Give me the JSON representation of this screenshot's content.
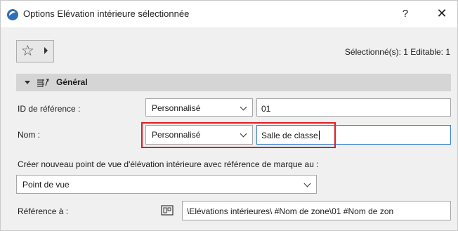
{
  "window": {
    "title": "Options Elévation intérieure sélectionnée",
    "help": "?",
    "close": "✕"
  },
  "toolbar": {
    "favorites_icon": "star-icon",
    "selection_info": "Sélectionné(s): 1 Editable: 1"
  },
  "section": {
    "title": "Général",
    "icon": "elevation-section-icon"
  },
  "fields": {
    "reference_id": {
      "label": "ID de référence :",
      "mode": "Personnalisé",
      "value": "01"
    },
    "name": {
      "label": "Nom :",
      "mode": "Personnalisé",
      "value": "Salle de classe"
    },
    "create_label": "Créer nouveau point de vue d'élévation intérieure avec référence de marque au :",
    "create_option": "Point de vue",
    "reference_to": {
      "label": "Référence à :",
      "icon": "reference-layout-icon",
      "value": "\\Elévations intérieures\\  #Nom de zone\\01 #Nom de zon"
    }
  },
  "colors": {
    "highlight": "#e01b24",
    "focus": "#3a7fd6",
    "section_bg": "#d5d5d5"
  }
}
